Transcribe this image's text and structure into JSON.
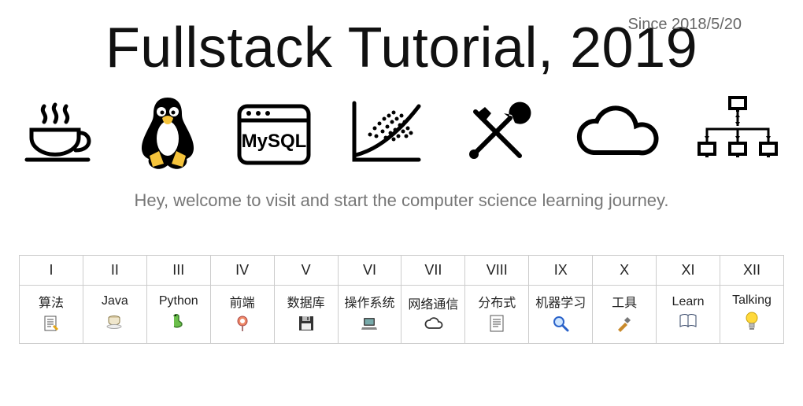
{
  "header": {
    "since": "Since 2018/5/20",
    "title": "Fullstack Tutorial, 2019",
    "subtitle": "Hey, welcome to visit and start the computer science learning journey."
  },
  "hero_icons": [
    {
      "name": "coffee-icon"
    },
    {
      "name": "linux-penguin-icon"
    },
    {
      "name": "mysql-icon",
      "text": "MySQL"
    },
    {
      "name": "chart-scatter-icon"
    },
    {
      "name": "tools-icon"
    },
    {
      "name": "cloud-icon"
    },
    {
      "name": "network-icon"
    }
  ],
  "nav": {
    "headers": [
      "I",
      "II",
      "III",
      "IV",
      "V",
      "VI",
      "VII",
      "VIII",
      "IX",
      "X",
      "XI",
      "XII"
    ],
    "items": [
      {
        "label": "算法",
        "icon": "memo-icon"
      },
      {
        "label": "Java",
        "icon": "coffee-small-icon"
      },
      {
        "label": "Python",
        "icon": "snake-icon"
      },
      {
        "label": "前端",
        "icon": "lollipop-icon"
      },
      {
        "label": "数据库",
        "icon": "floppy-icon"
      },
      {
        "label": "操作系统",
        "icon": "laptop-icon"
      },
      {
        "label": "网络通信",
        "icon": "cloud-small-icon"
      },
      {
        "label": "分布式",
        "icon": "page-icon"
      },
      {
        "label": "机器学习",
        "icon": "magnify-icon"
      },
      {
        "label": "工具",
        "icon": "hammer-icon"
      },
      {
        "label": "Learn",
        "icon": "book-icon"
      },
      {
        "label": "Talking",
        "icon": "bulb-icon"
      }
    ]
  }
}
